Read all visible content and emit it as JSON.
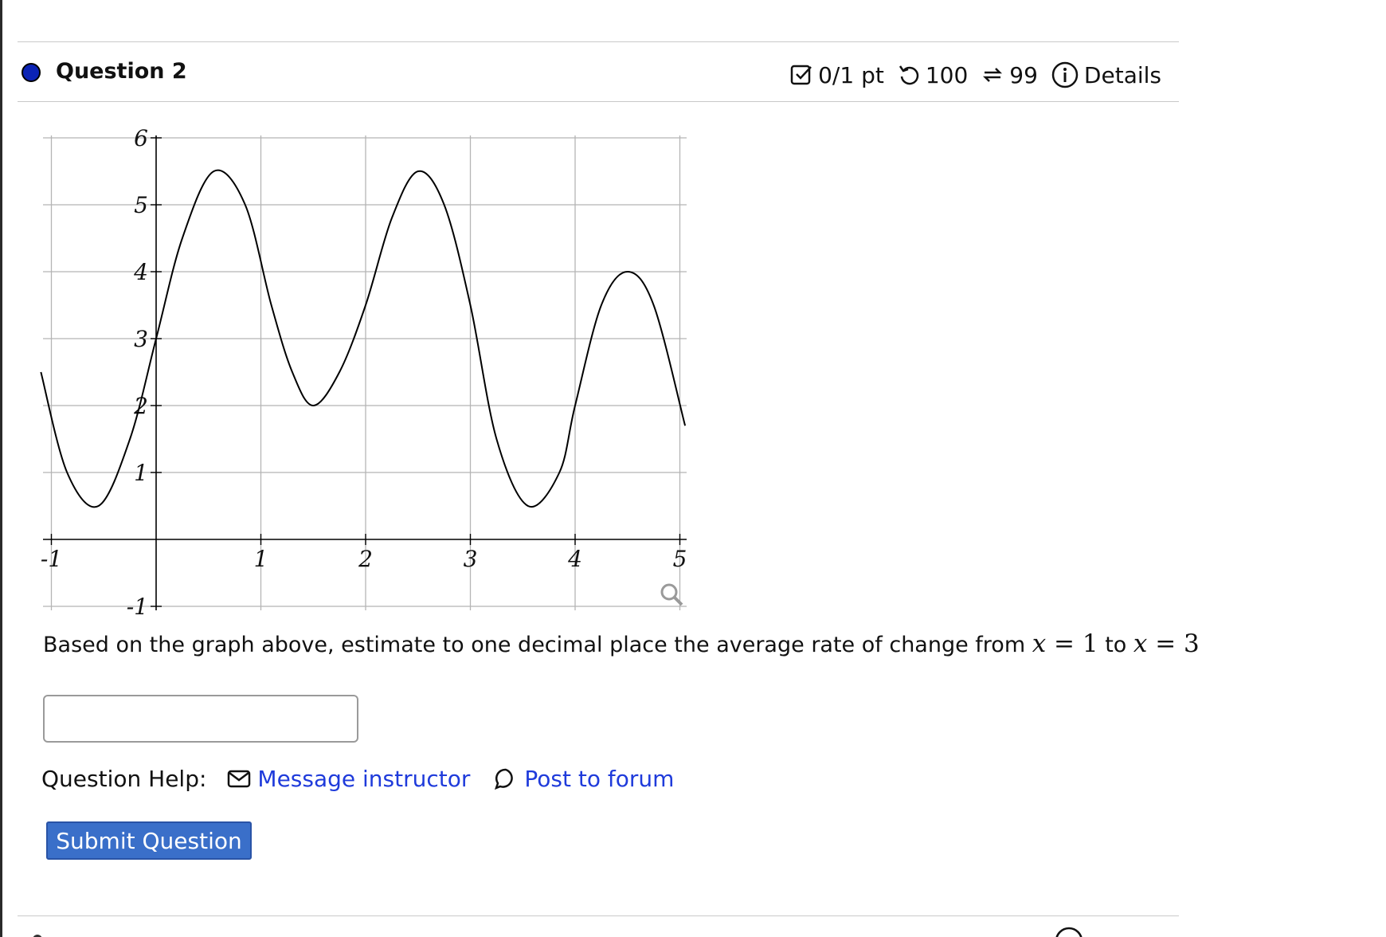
{
  "question": {
    "title": "Question 2",
    "score": "0/1 pt",
    "attempts": "100",
    "retries": "99",
    "details_label": "Details"
  },
  "graph": {
    "x_ticks": [
      "-1",
      "1",
      "2",
      "3",
      "4",
      "5"
    ],
    "y_ticks": [
      "6",
      "5",
      "4",
      "3",
      "2",
      "1",
      "-1"
    ],
    "curve_points": [
      [
        -1.1,
        2.5
      ],
      [
        -0.85,
        1.0
      ],
      [
        -0.55,
        0.5
      ],
      [
        -0.25,
        1.5
      ],
      [
        0,
        3.0
      ],
      [
        0.25,
        4.5
      ],
      [
        0.55,
        5.5
      ],
      [
        0.85,
        5.0
      ],
      [
        1.1,
        3.5
      ],
      [
        1.3,
        2.5
      ],
      [
        1.5,
        2.0
      ],
      [
        1.75,
        2.5
      ],
      [
        2.0,
        3.5
      ],
      [
        2.25,
        4.8
      ],
      [
        2.5,
        5.5
      ],
      [
        2.75,
        5.0
      ],
      [
        3.0,
        3.5
      ],
      [
        3.25,
        1.5
      ],
      [
        3.55,
        0.5
      ],
      [
        3.85,
        1.0
      ],
      [
        4.0,
        2.0
      ],
      [
        4.25,
        3.5
      ],
      [
        4.5,
        4.0
      ],
      [
        4.75,
        3.5
      ],
      [
        5.05,
        1.7
      ]
    ]
  },
  "prompt": {
    "text_before": "Based on the graph above, estimate to one decimal place the average rate of change from ",
    "var1": "x",
    "eq1": " = 1",
    "text_mid": " to ",
    "var2": "x",
    "eq2": " = 3"
  },
  "answer": {
    "value": "",
    "placeholder": ""
  },
  "help": {
    "label": "Question Help:",
    "message_instructor": "Message instructor",
    "post_to_forum": "Post to forum"
  },
  "submit": {
    "label": "Submit Question"
  },
  "colors": {
    "status_dot": "#0b23b5",
    "link": "#1f3bdb",
    "submit_bg": "#3a6fc9"
  }
}
